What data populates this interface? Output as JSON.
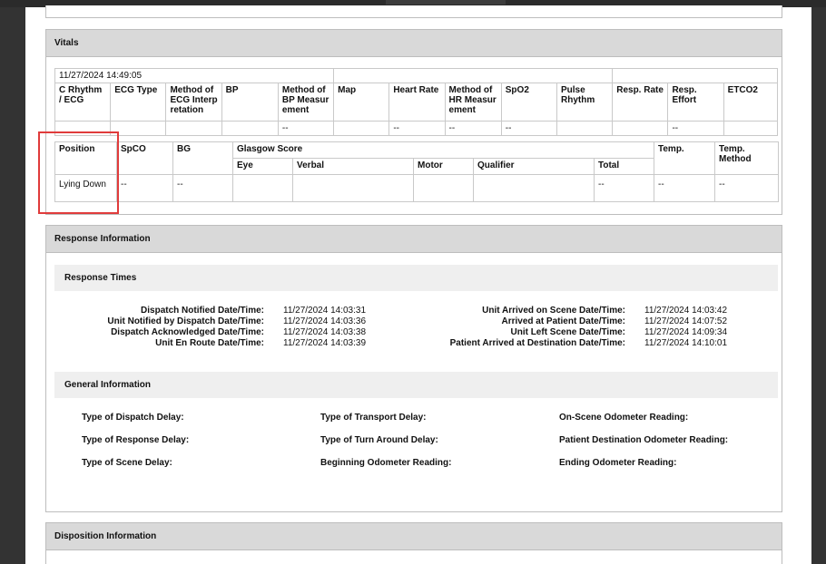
{
  "vitals": {
    "title": "Vitals",
    "timestamp": "11/27/2024 14:49:05",
    "row1_headers": [
      "C Rhythm / ECG",
      "ECG Type",
      "Method of ECG Interp retation",
      "BP",
      "Method of BP Measur ement",
      "Map",
      "Heart Rate",
      "Method of HR Measur ement",
      "SpO2",
      "Pulse Rhythm",
      "Resp. Rate",
      "Resp. Effort",
      "ETCO2"
    ],
    "row1_values": [
      "",
      "",
      "",
      "",
      "--",
      "",
      "--",
      "--",
      "--",
      "",
      "",
      "--",
      ""
    ],
    "row2": {
      "position_header": "Position",
      "spco_header": "SpCO",
      "bg_header": "BG",
      "glasgow_header": "Glasgow Score",
      "eye_header": "Eye",
      "verbal_header": "Verbal",
      "motor_header": "Motor",
      "qualifier_header": "Qualifier",
      "total_header": "Total",
      "temp_header": "Temp.",
      "temp_method_header": "Temp. Method",
      "position_value": "Lying Down",
      "spco_value": "--",
      "bg_value": "--",
      "eye_value": "",
      "verbal_value": "",
      "motor_value": "",
      "qualifier_value": "",
      "total_value": "--",
      "temp_value": "--",
      "temp_method_value": "--"
    }
  },
  "response": {
    "title": "Response Information",
    "times_title": "Response Times",
    "left_labels": [
      "Dispatch Notified Date/Time:",
      "Unit Notified by Dispatch Date/Time:",
      "Dispatch Acknowledged Date/Time:",
      "Unit En Route Date/Time:"
    ],
    "left_values": [
      "11/27/2024 14:03:31",
      "11/27/2024 14:03:36",
      "11/27/2024 14:03:38",
      "11/27/2024 14:03:39"
    ],
    "right_labels": [
      "Unit Arrived on Scene Date/Time:",
      "Arrived at Patient Date/Time:",
      "Unit Left Scene Date/Time:",
      "Patient Arrived at Destination Date/Time:"
    ],
    "right_values": [
      "11/27/2024 14:03:42",
      "11/27/2024 14:07:52",
      "11/27/2024 14:09:34",
      "11/27/2024 14:10:01"
    ],
    "general_title": "General Information",
    "general_col1": [
      "Type of Dispatch Delay:",
      "Type of Response Delay:",
      "Type of Scene Delay:"
    ],
    "general_col2": [
      "Type of Transport Delay:",
      "Type of Turn Around Delay:",
      "Beginning Odometer Reading:"
    ],
    "general_col3": [
      "On-Scene Odometer Reading:",
      "Patient Destination Odometer Reading:",
      "Ending Odometer Reading:"
    ]
  },
  "disposition": {
    "title": "Disposition Information"
  }
}
